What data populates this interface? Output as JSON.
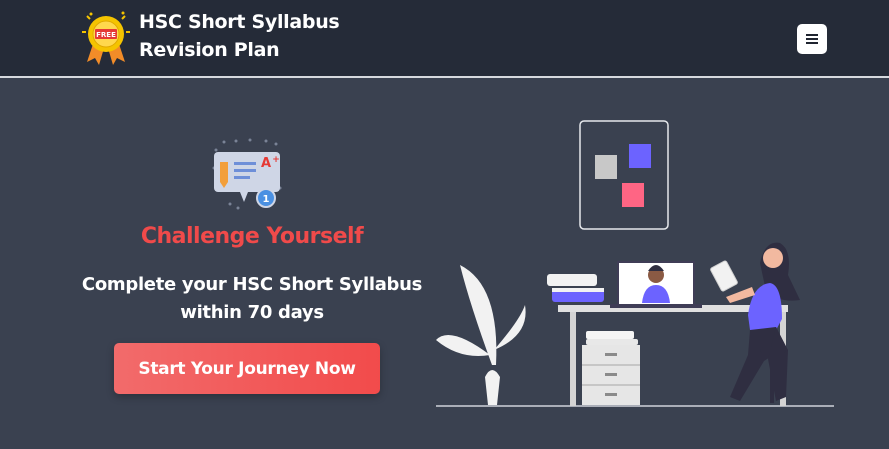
{
  "header": {
    "logo_icon": "free-badge-icon",
    "logo_text": "FREE",
    "brand_line1": "HSC Short Syllabus",
    "brand_line2": "Revision Plan",
    "menu_icon": "hamburger-menu-icon"
  },
  "hero": {
    "icon": "grade-certificate-icon",
    "headline": "Challenge Yourself",
    "subline1": "Complete your HSC Short Syllabus",
    "subline2": "within 70 days",
    "cta_label": "Start Your Journey Now",
    "illustration": "person-studying-at-desk-illustration"
  },
  "colors": {
    "header_bg": "#252b38",
    "page_bg": "#3a4150",
    "accent_red": "#f04a4a",
    "accent_purple": "#6c63ff"
  }
}
